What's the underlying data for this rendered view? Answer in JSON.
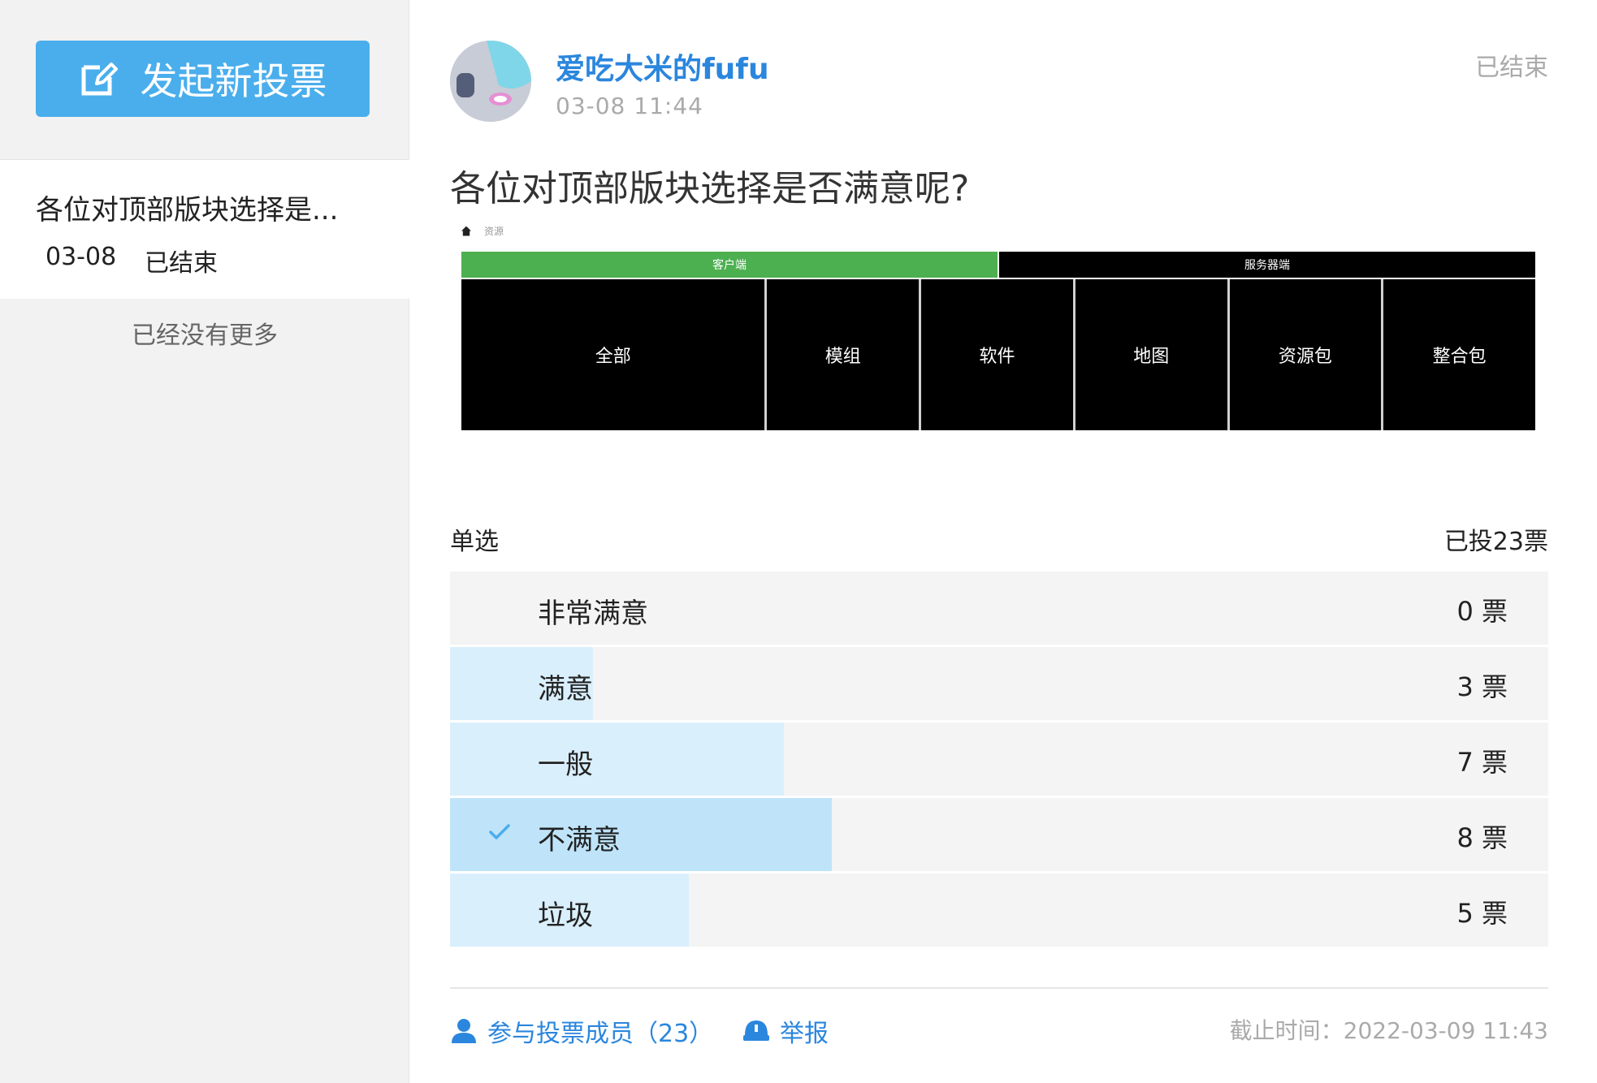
{
  "sidebar": {
    "new_vote_label": "发起新投票",
    "poll_items": [
      {
        "title": "各位对顶部版块选择是...",
        "date": "03-08",
        "status": "已结束"
      }
    ],
    "no_more": "已经没有更多"
  },
  "post": {
    "author": "爱吃大米的fufu",
    "time": "03-08 11:44",
    "status": "已结束",
    "question": "各位对顶部版块选择是否满意呢?"
  },
  "embed": {
    "breadcrumb": "资源",
    "tabs": [
      "客户端",
      "服务器端"
    ],
    "cells": [
      "全部",
      "模组",
      "软件",
      "地图",
      "资源包",
      "整合包"
    ]
  },
  "poll": {
    "type": "单选",
    "total": "已投23票",
    "options": [
      {
        "label": "非常满意",
        "count": "0 票",
        "votes": 0,
        "selected": false
      },
      {
        "label": "满意",
        "count": "3 票",
        "votes": 3,
        "selected": false
      },
      {
        "label": "一般",
        "count": "7 票",
        "votes": 7,
        "selected": false
      },
      {
        "label": "不满意",
        "count": "8 票",
        "votes": 8,
        "selected": true
      },
      {
        "label": "垃圾",
        "count": "5 票",
        "votes": 5,
        "selected": false
      }
    ],
    "total_votes": 23
  },
  "footer": {
    "members": "参与投票成员（23）",
    "report": "举报",
    "deadline": "截止时间：2022-03-09 11:43"
  },
  "colors": {
    "accent": "#4aaeec",
    "link": "#2b86dd",
    "bar": "#daeffc",
    "bar_selected": "#bfe4fa"
  }
}
